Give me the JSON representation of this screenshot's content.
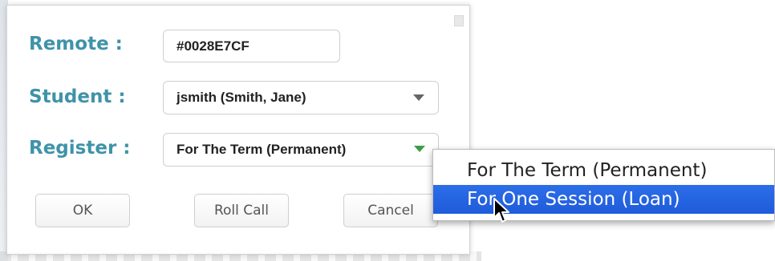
{
  "form": {
    "remote": {
      "label": "Remote :",
      "value": "#0028E7CF"
    },
    "student": {
      "label": "Student :",
      "value": "jsmith (Smith, Jane)"
    },
    "register": {
      "label": "Register :",
      "value": "For The Term (Permanent)"
    }
  },
  "buttons": {
    "ok": "OK",
    "roll_call": "Roll Call",
    "cancel": "Cancel"
  },
  "dropdown_menu": {
    "items": [
      "For The Term (Permanent)",
      "For One Session (Loan)"
    ],
    "highlighted_index": 1
  },
  "colors": {
    "label": "#3f93a8",
    "highlight": "#2c6ee8",
    "register_caret": "#3e9c47"
  },
  "icons": [
    "dropdown-caret-icon",
    "mouse-pointer-icon"
  ]
}
